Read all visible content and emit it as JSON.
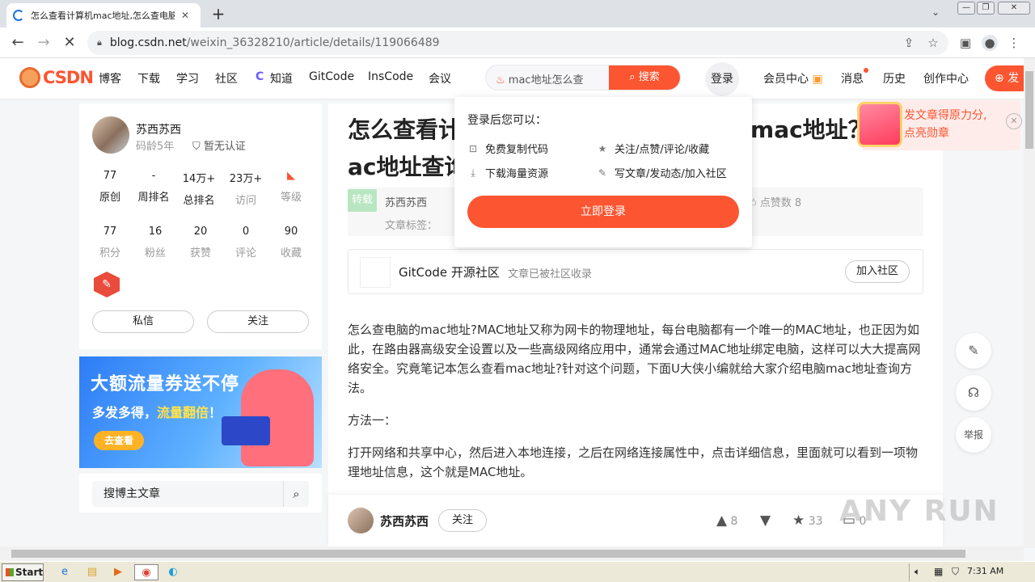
{
  "browser": {
    "tab_title": "怎么查看计算机mac地址,怎么查电脑",
    "url_host": "blog.csdn.net",
    "url_path": "/weixin_36328210/article/details/119066489",
    "newtab": "+",
    "win_min": "—",
    "win_max": "❐",
    "win_close": "✕"
  },
  "header": {
    "logo": "CSDN",
    "nav": [
      "博客",
      "下载",
      "学习",
      "社区",
      "知道",
      "GitCode",
      "InsCode",
      "会议"
    ],
    "search_placeholder": "mac地址怎么查",
    "search_button": "搜索",
    "login": "登录",
    "right_nav": [
      "会员中心",
      "消息",
      "历史",
      "创作中心"
    ],
    "create": "发"
  },
  "profile": {
    "name": "苏西苏西",
    "age": "码龄5年",
    "verify": "暂无认证",
    "stats1": [
      {
        "v": "77",
        "l": "原创"
      },
      {
        "v": "-",
        "l": "周排名"
      },
      {
        "v": "14万+",
        "l": "总排名"
      },
      {
        "v": "23万+",
        "l": "访问"
      },
      {
        "v": "",
        "l": "等级"
      }
    ],
    "stats2": [
      {
        "v": "77",
        "l": "积分"
      },
      {
        "v": "16",
        "l": "粉丝"
      },
      {
        "v": "20",
        "l": "获赞"
      },
      {
        "v": "0",
        "l": "评论"
      },
      {
        "v": "90",
        "l": "收藏"
      }
    ],
    "message": "私信",
    "follow": "关注"
  },
  "banner": {
    "line1": "大额流量券送不停",
    "line2a": "多发多得，",
    "line2b": "流量翻倍",
    "line2c": "！",
    "cta": "去查看"
  },
  "side_search": {
    "placeholder": "搜博主文章"
  },
  "article": {
    "title_line1": "怎么查看计",
    "title_mid": "mac地址？",
    "title_line2": "ac地址查询",
    "tag": "转载",
    "author": "苏西苏西",
    "likes_text": "点赞数 8",
    "tags_label": "文章标签：",
    "gitcode_name": "GitCode 开源社区",
    "gitcode_desc": "文章已被社区收录",
    "gitcode_join": "加入社区",
    "p1": "怎么查电脑的mac地址?MAC地址又称为网卡的物理地址，每台电脑都有一个唯一的MAC地址，也正因为如此，在路由器高级安全设置以及一些高级网络应用中，通常会通过MAC地址绑定电脑，这样可以大大提高网络安全。究竟笔记本怎么查看mac地址?针对这个问题，下面U大侠小编就给大家介绍电脑mac地址查询方法。",
    "p2": "方法一：",
    "p3": "打开网络和共享中心，然后进入本地连接，之后在网络连接属性中，点击详细信息，里面就可以看到一项物理地址信息，这个就是MAC地址。"
  },
  "bottom_bar": {
    "author": "苏西苏西",
    "follow": "关注",
    "like_count": "8",
    "star_count": "33",
    "comment_count": "0"
  },
  "login_popup": {
    "heading": "登录后您可以：",
    "features": [
      "免费复制代码",
      "关注/点赞/评论/收藏",
      "下载海量资源",
      "写文章/发动态/加入社区"
    ],
    "button": "立即登录"
  },
  "promo": {
    "line1": "发文章得原力分,",
    "line2": "点亮勋章"
  },
  "tools": {
    "report": "举报"
  },
  "taskbar": {
    "start": "Start",
    "clock": "7:31 AM"
  },
  "watermark": "ANY RUN",
  "colors": {
    "accent": "#fc5531",
    "link": "#1a73e8"
  }
}
